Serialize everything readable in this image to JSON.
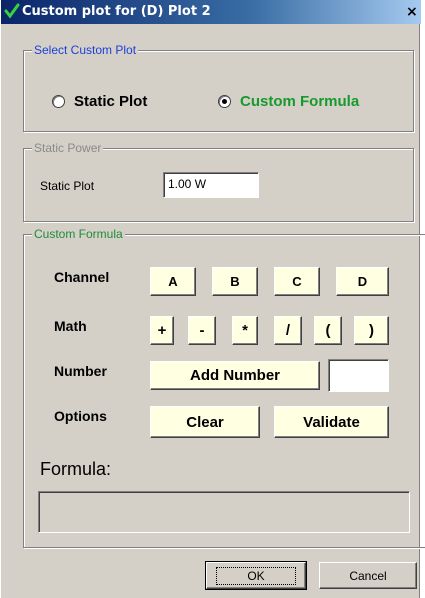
{
  "window": {
    "title": "Custom plot for (D) Plot 2",
    "close_glyph": "×",
    "title_icon": "check-icon"
  },
  "select_custom_plot": {
    "legend": "Select Custom Plot",
    "options": [
      {
        "label": "Static Plot",
        "selected": false
      },
      {
        "label": "Custom Formula",
        "selected": true
      }
    ]
  },
  "static_power": {
    "legend": "Static Power",
    "field_label": "Static Plot",
    "field_value": "1.00 W"
  },
  "custom_formula": {
    "legend": "Custom Formula",
    "channel": {
      "label": "Channel",
      "buttons": [
        "A",
        "B",
        "C",
        "D"
      ]
    },
    "math": {
      "label": "Math",
      "buttons": [
        "+",
        "-",
        "*",
        "/",
        "(",
        ")"
      ]
    },
    "number": {
      "label": "Number",
      "button": "Add Number",
      "value": ""
    },
    "options": {
      "label": "Options",
      "clear": "Clear",
      "validate": "Validate"
    },
    "formula_label": "Formula:",
    "formula_value": ""
  },
  "footer": {
    "ok": "OK",
    "cancel": "Cancel"
  },
  "colors": {
    "dialog_bg": "#d4d0c8",
    "title_start": "#0a246a",
    "title_end": "#a6caf0",
    "button_face": "#ffffe1",
    "legend_blue": "#1c3fd8",
    "legend_green": "#1e8c3a",
    "custom_formula_green": "#169a2c"
  }
}
